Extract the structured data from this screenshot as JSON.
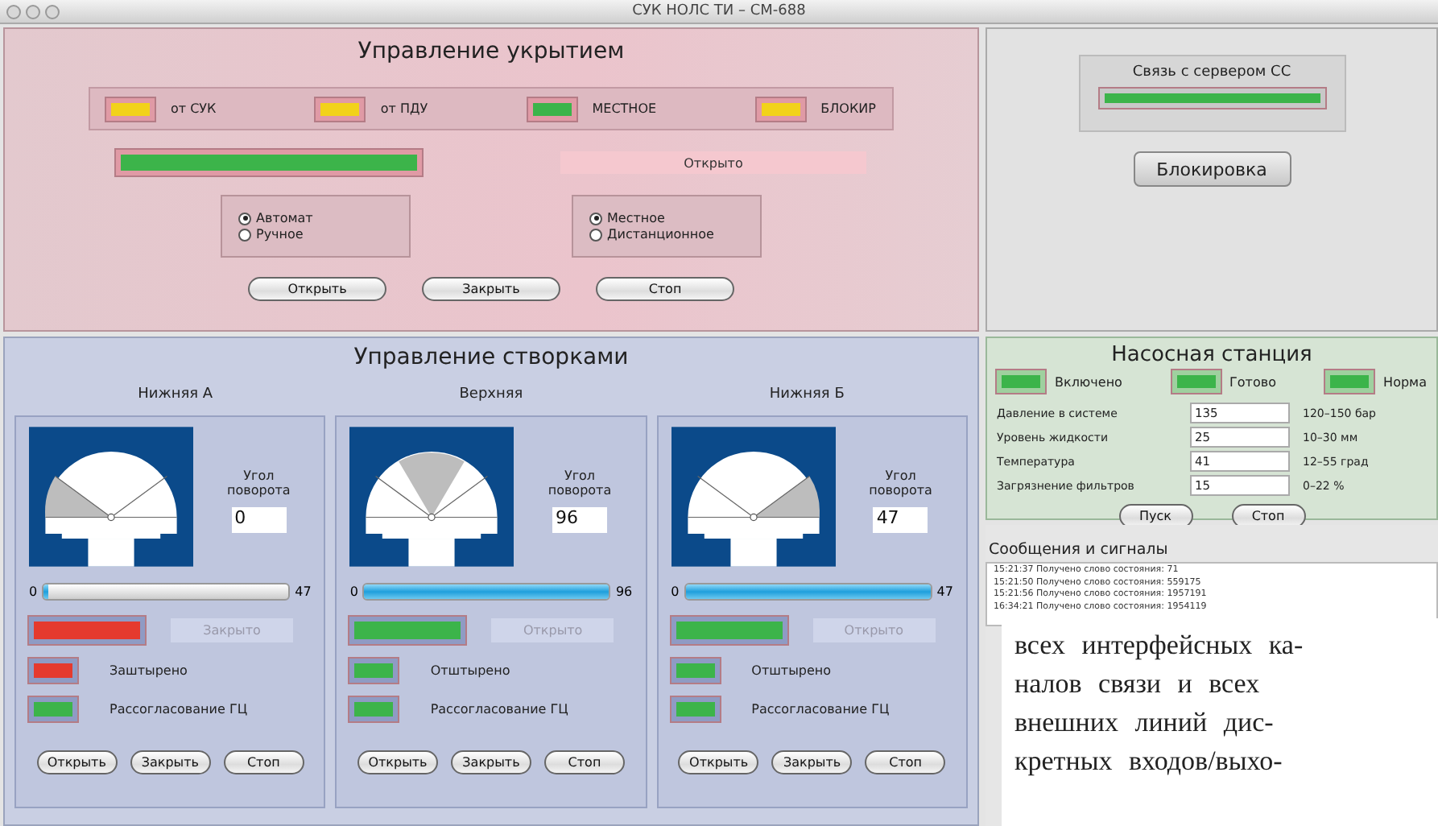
{
  "window": {
    "title": "СУК НОЛС ТИ – СМ-688"
  },
  "cover": {
    "title": "Управление укрытием",
    "sources": [
      {
        "label": "от СУК",
        "color": "#f2d21a"
      },
      {
        "label": "от ПДУ",
        "color": "#f2d21a"
      },
      {
        "label": "МЕСТНОЕ",
        "color": "#3cb44a"
      },
      {
        "label": "БЛОКИР",
        "color": "#f2d21a"
      }
    ],
    "position": {
      "color": "#3cb44a",
      "label": "Открыто"
    },
    "mode_groups": [
      {
        "options": [
          {
            "label": "Автомат",
            "selected": true
          },
          {
            "label": "Ручное",
            "selected": false
          }
        ]
      },
      {
        "options": [
          {
            "label": "Местное",
            "selected": true
          },
          {
            "label": "Дистанционное",
            "selected": false
          }
        ]
      }
    ],
    "buttons": [
      "Открыть",
      "Закрыть",
      "Стоп"
    ]
  },
  "shutters": {
    "title": "Управление створками",
    "items": [
      {
        "name": "Нижняя А",
        "kind": "left",
        "angle_label": "Угол поворота",
        "angle": "0",
        "min": "0",
        "max": "47",
        "level": 0,
        "state": {
          "color": "#e53a2e",
          "label": "Закрыто"
        },
        "lamps": [
          {
            "label": "Заштырено",
            "color": "#e53a2e"
          },
          {
            "label": "Рассогласование ГЦ",
            "color": "#3cb44a"
          }
        ],
        "buttons": [
          "Открыть",
          "Закрыть",
          "Стоп"
        ]
      },
      {
        "name": "Верхняя",
        "kind": "top",
        "angle_label": "Угол поворота",
        "angle": "96",
        "min": "0",
        "max": "96",
        "level": 1,
        "state": {
          "color": "#3cb44a",
          "label": "Открыто"
        },
        "lamps": [
          {
            "label": "Отштырено",
            "color": "#3cb44a"
          },
          {
            "label": "Рассогласование ГЦ",
            "color": "#3cb44a"
          }
        ],
        "buttons": [
          "Открыть",
          "Закрыть",
          "Стоп"
        ]
      },
      {
        "name": "Нижняя Б",
        "kind": "right",
        "angle_label": "Угол поворота",
        "angle": "47",
        "min": "0",
        "max": "47",
        "level": 1,
        "state": {
          "color": "#3cb44a",
          "label": "Открыто"
        },
        "lamps": [
          {
            "label": "Отштырено",
            "color": "#3cb44a"
          },
          {
            "label": "Рассогласование ГЦ",
            "color": "#3cb44a"
          }
        ],
        "buttons": [
          "Открыть",
          "Закрыть",
          "Стоп"
        ]
      }
    ]
  },
  "server": {
    "label": "Связь с сервером СС",
    "color": "#3cb44a",
    "button": "Блокировка"
  },
  "pump": {
    "title": "Насосная станция",
    "indicators": [
      {
        "label": "Включено",
        "color": "#3cb44a"
      },
      {
        "label": "Готово",
        "color": "#3cb44a"
      },
      {
        "label": "Норма",
        "color": "#3cb44a"
      }
    ],
    "params": [
      {
        "label": "Давление в системе",
        "value": "135",
        "range": "120–150 бар"
      },
      {
        "label": "Уровень жидкости",
        "value": "25",
        "range": "10–30 мм"
      },
      {
        "label": "Температура",
        "value": "41",
        "range": "12–55 град"
      },
      {
        "label": "Загрязнение фильтров",
        "value": "15",
        "range": "0–22 %"
      }
    ],
    "buttons": [
      "Пуск",
      "Стоп"
    ]
  },
  "messages": {
    "title": "Сообщения и сигналы",
    "lines": [
      "15:21:37 Получено слово состояния: 71",
      "15:21:50 Получено слово состояния: 559175",
      "15:21:56 Получено слово состояния: 1957191",
      "16:34:21 Получено слово состояния: 1954119"
    ]
  },
  "print_text": {
    "lines": [
      "всех интерфейсных ка-",
      "налов связи и всех",
      "внешних линий дис-",
      "кретных входов/выхо-"
    ]
  }
}
